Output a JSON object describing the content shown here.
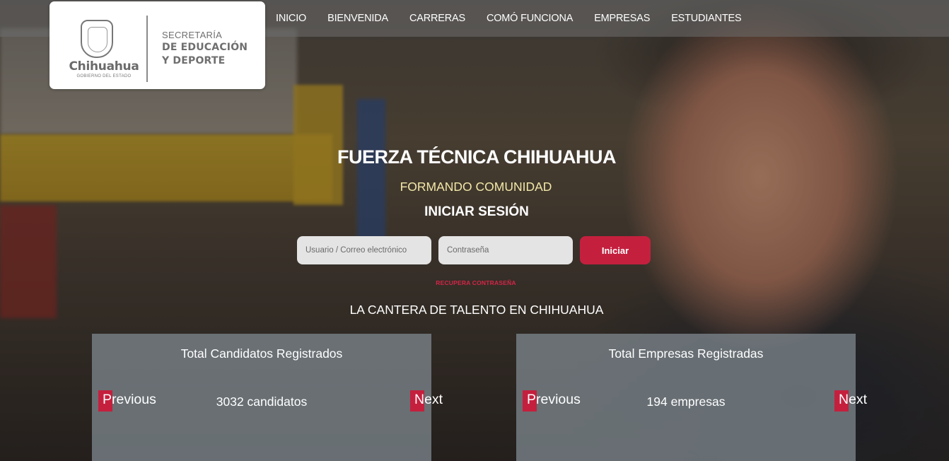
{
  "header": {
    "logo": {
      "state_name": "Chihuahua",
      "state_sub": "GOBIERNO DEL ESTADO",
      "dept_line1": "SECRETARÍA",
      "dept_line2": "DE EDUCACIÓN",
      "dept_line3": "Y DEPORTE"
    },
    "nav": [
      "INICIO",
      "BIENVENIDA",
      "CARRERAS",
      "COMÓ FUNCIONA",
      "EMPRESAS",
      "ESTUDIANTES"
    ]
  },
  "hero": {
    "headline": "FUERZA TÉCNICA CHIHUAHUA",
    "subline": "FORMANDO COMUNIDAD",
    "login_title": "INICIAR SESIÓN",
    "user_placeholder": "Usuario / Correo electrónico",
    "password_placeholder": "Contraseña",
    "login_button": "Iniciar",
    "recover_link": "RECUPERA CONTRASEÑA",
    "tagline": "LA CANTERA DE TALENTO EN CHIHUAHUA"
  },
  "stats": {
    "candidates": {
      "title": "Total Candidatos Registrados",
      "value": "3032 candidatos",
      "prev": "Previous",
      "next": "Next"
    },
    "companies": {
      "title": "Total Empresas Registradas",
      "value": "194 empresas",
      "prev": "Previous",
      "next": "Next"
    }
  },
  "colors": {
    "accent": "#c4203e",
    "subline": "#f2e7a8",
    "card": "#78808a"
  }
}
